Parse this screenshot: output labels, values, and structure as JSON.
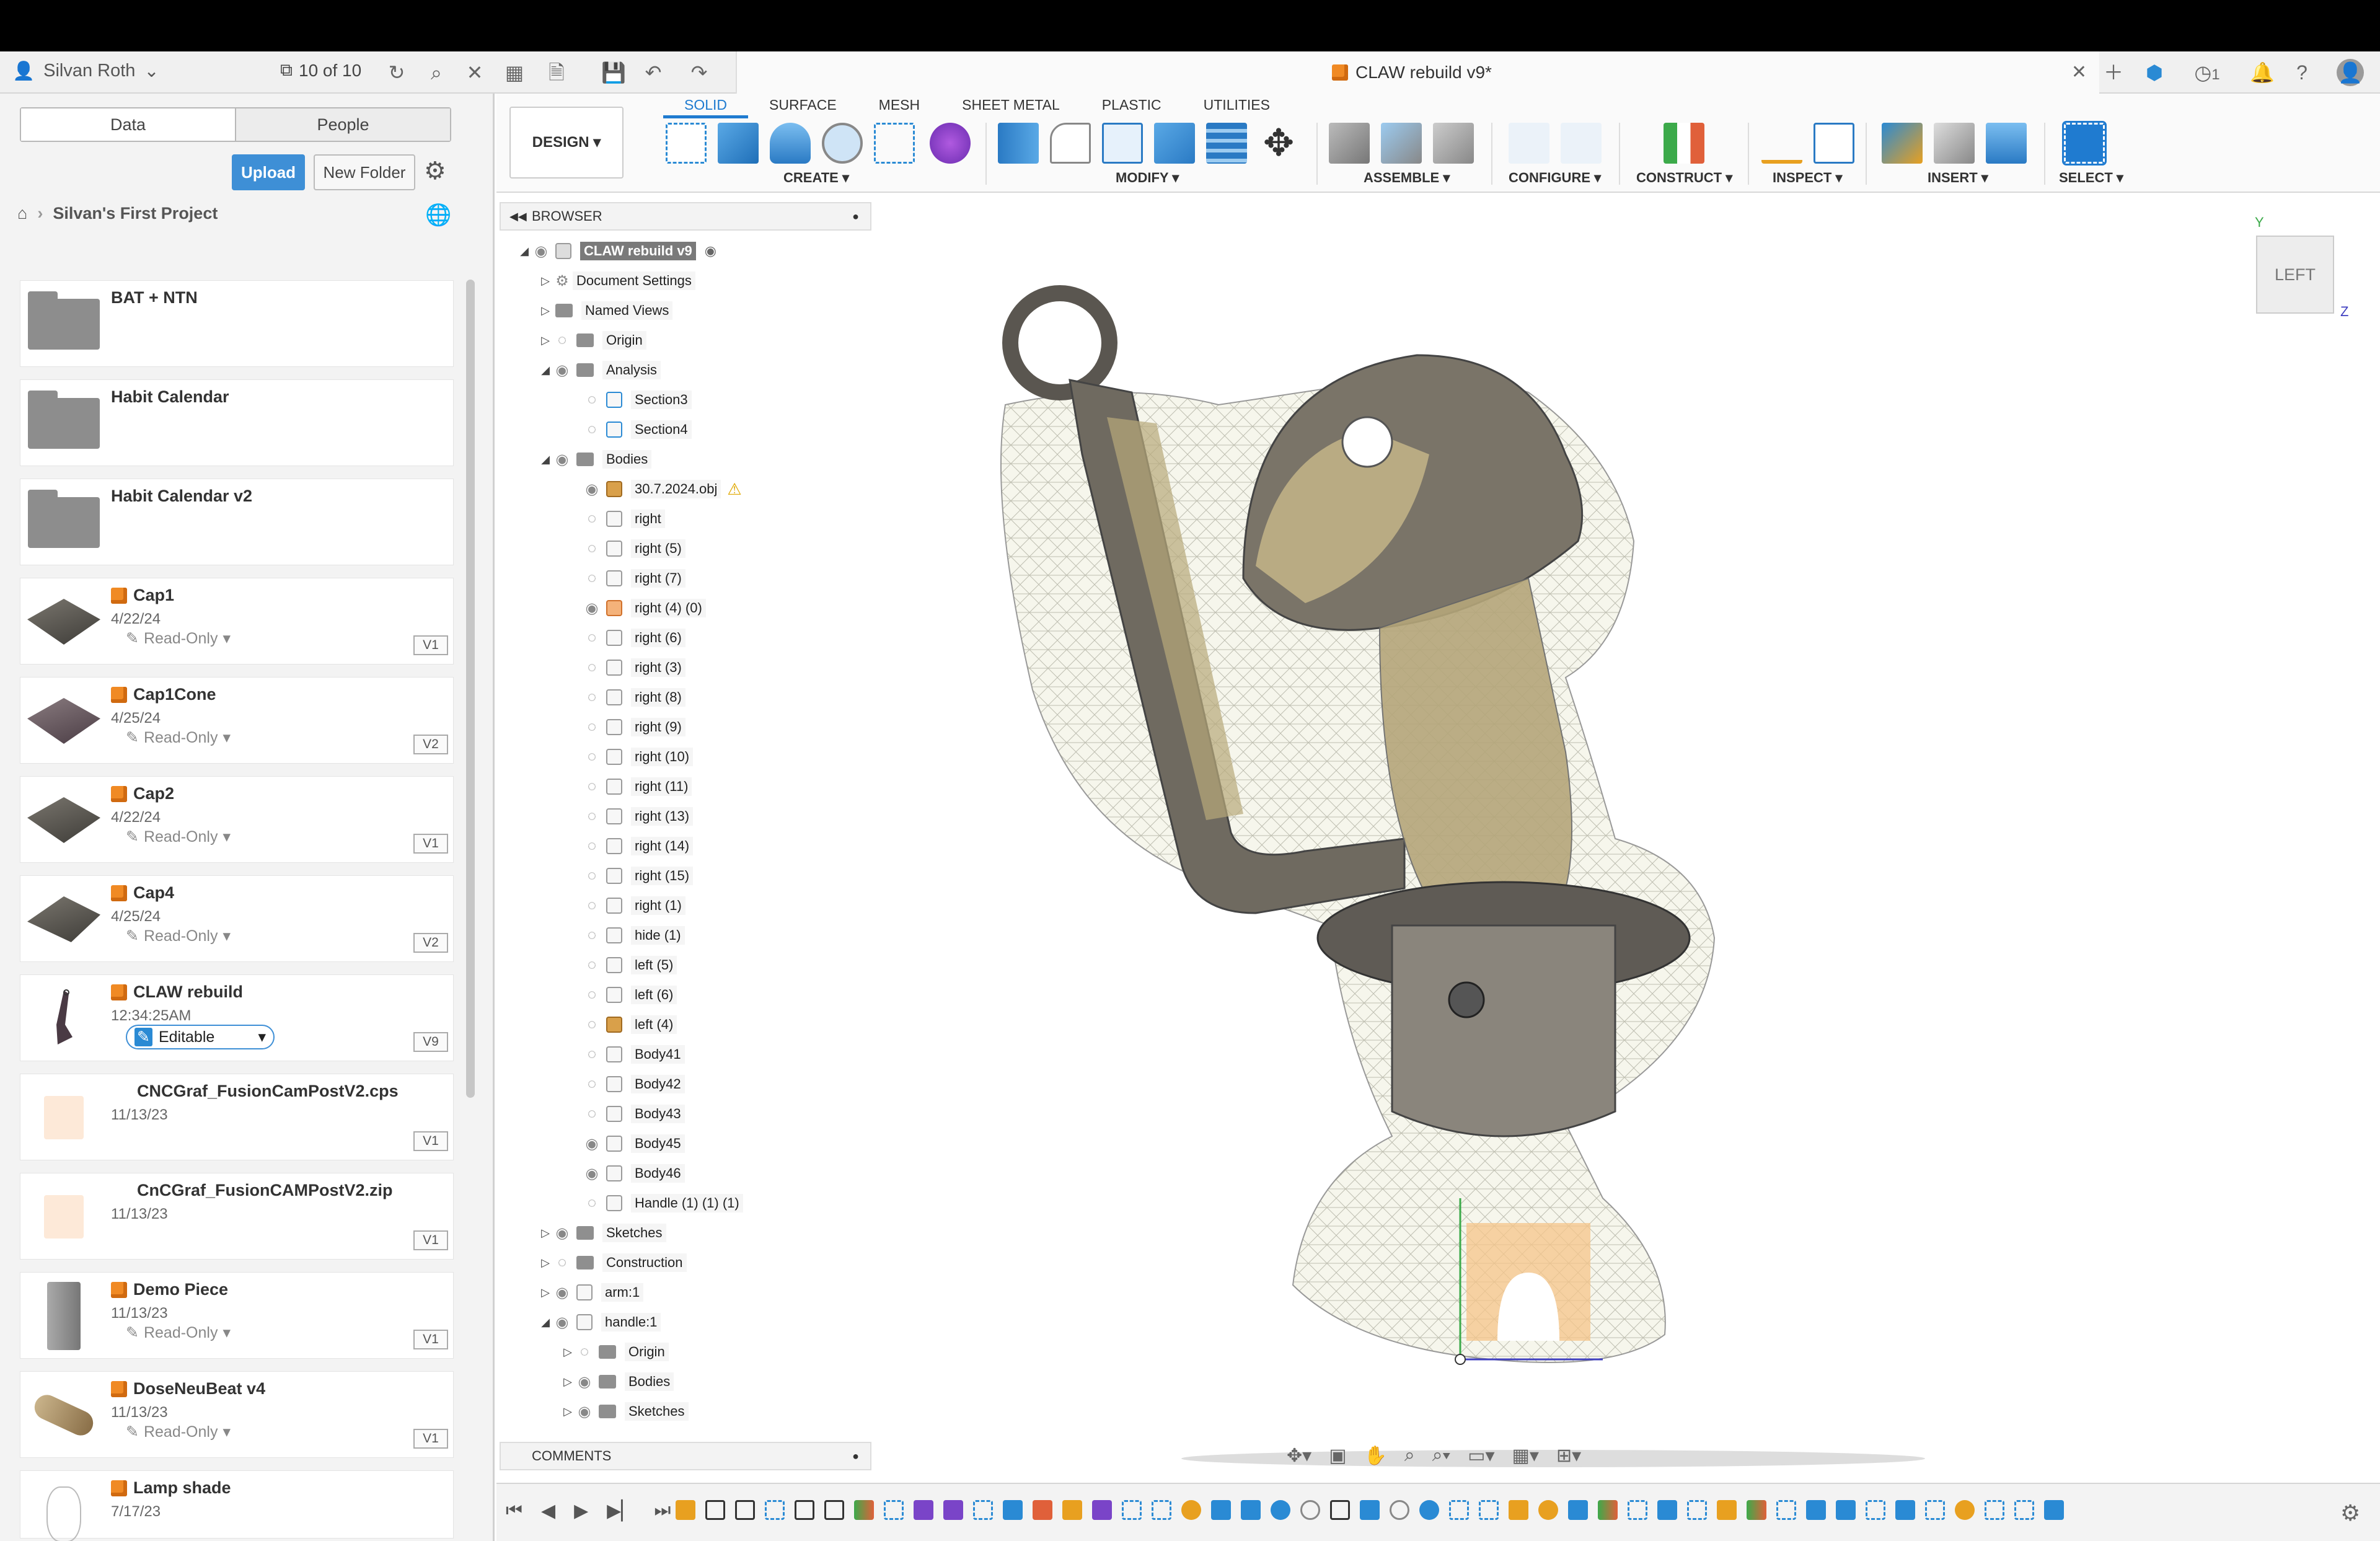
{
  "appbar": {
    "user": "Silvan Roth",
    "version_counter": "10 of 10",
    "doc_tab_title": "CLAW rebuild v9*",
    "jobs_count": "1"
  },
  "data_panel": {
    "tab_data": "Data",
    "tab_people": "People",
    "upload": "Upload",
    "new_folder": "New Folder",
    "project": "Silvan's First Project",
    "files": [
      {
        "name": "BAT + NTN",
        "type": "folder"
      },
      {
        "name": "Habit Calendar",
        "type": "folder"
      },
      {
        "name": "Habit Calendar v2",
        "type": "folder"
      },
      {
        "name": "Cap1",
        "date": "4/22/24",
        "status": "Read-Only",
        "version": "V1"
      },
      {
        "name": "Cap1Cone",
        "date": "4/25/24",
        "status": "Read-Only",
        "version": "V2"
      },
      {
        "name": "Cap2",
        "date": "4/22/24",
        "status": "Read-Only",
        "version": "V1"
      },
      {
        "name": "Cap4",
        "date": "4/25/24",
        "status": "Read-Only",
        "version": "V2"
      },
      {
        "name": "CLAW rebuild",
        "date": "12:34:25AM",
        "status": "Editable",
        "version": "V9"
      },
      {
        "name": "CNCGraf_FusionCamPostV2.cps",
        "date": "11/13/23",
        "version": "V1"
      },
      {
        "name": "CnCGraf_FusionCAMPostV2.zip",
        "date": "11/13/23",
        "version": "V1"
      },
      {
        "name": "Demo Piece",
        "date": "11/13/23",
        "status": "Read-Only",
        "version": "V1"
      },
      {
        "name": "DoseNeuBeat v4",
        "date": "11/13/23",
        "status": "Read-Only",
        "version": "V1"
      },
      {
        "name": "Lamp shade",
        "date": "7/17/23",
        "status": "",
        "version": ""
      }
    ]
  },
  "toolbar": {
    "workspace": "DESIGN",
    "tabs": [
      "SOLID",
      "SURFACE",
      "MESH",
      "SHEET METAL",
      "PLASTIC",
      "UTILITIES"
    ],
    "groups": [
      "CREATE",
      "MODIFY",
      "ASSEMBLE",
      "CONFIGURE",
      "CONSTRUCT",
      "INSPECT",
      "INSERT",
      "SELECT"
    ]
  },
  "browser": {
    "title": "BROWSER",
    "comments": "COMMENTS",
    "rows": [
      {
        "label": "CLAW rebuild v9"
      },
      {
        "label": "Document Settings"
      },
      {
        "label": "Named Views"
      },
      {
        "label": "Origin"
      },
      {
        "label": "Analysis"
      },
      {
        "label": "Section3"
      },
      {
        "label": "Section4"
      },
      {
        "label": "Bodies"
      },
      {
        "label": "30.7.2024.obj"
      },
      {
        "label": "right"
      },
      {
        "label": "right (5)"
      },
      {
        "label": "right (7)"
      },
      {
        "label": "right (4) (0)"
      },
      {
        "label": "right (6)"
      },
      {
        "label": "right (3)"
      },
      {
        "label": "right (8)"
      },
      {
        "label": "right (9)"
      },
      {
        "label": "right (10)"
      },
      {
        "label": "right (11)"
      },
      {
        "label": "right (13)"
      },
      {
        "label": "right (14)"
      },
      {
        "label": "right (15)"
      },
      {
        "label": "right (1)"
      },
      {
        "label": "hide (1)"
      },
      {
        "label": "left (5)"
      },
      {
        "label": "left (6)"
      },
      {
        "label": "left (4)"
      },
      {
        "label": "Body41"
      },
      {
        "label": "Body42"
      },
      {
        "label": "Body43"
      },
      {
        "label": "Body45"
      },
      {
        "label": "Body46"
      },
      {
        "label": "Handle (1) (1) (1)"
      },
      {
        "label": "Sketches"
      },
      {
        "label": "Construction"
      },
      {
        "label": "arm:1"
      },
      {
        "label": "handle:1"
      },
      {
        "label": "Origin"
      },
      {
        "label": "Bodies"
      },
      {
        "label": "Sketches"
      }
    ]
  },
  "viewcube": {
    "face": "LEFT",
    "axis_y": "Y",
    "axis_z": "Z"
  },
  "colors": {
    "accent": "#1f7bd0",
    "fusion_orange": "#f08a24"
  }
}
